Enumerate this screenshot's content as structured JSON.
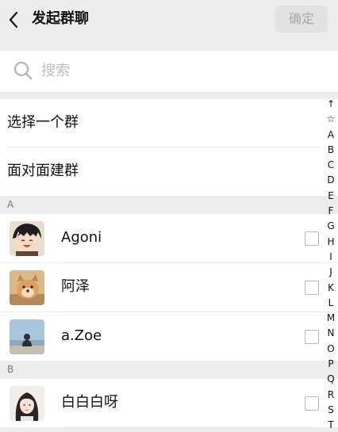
{
  "header": {
    "title": "发起群聊",
    "confirm_label": "确定"
  },
  "search": {
    "placeholder": "搜索"
  },
  "actions": [
    {
      "label": "选择一个群"
    },
    {
      "label": "面对面建群"
    }
  ],
  "sections": [
    {
      "letter": "A",
      "contacts": [
        {
          "name": "Agoni"
        },
        {
          "name": "阿泽"
        },
        {
          "name": "a.Zoe"
        }
      ]
    },
    {
      "letter": "B",
      "contacts": [
        {
          "name": "白白白呀"
        }
      ]
    }
  ],
  "index_letters": [
    "↑",
    "☆",
    "A",
    "B",
    "C",
    "D",
    "E",
    "F",
    "G",
    "H",
    "I",
    "J",
    "K",
    "L",
    "M",
    "N",
    "O",
    "P",
    "Q",
    "R",
    "S",
    "T"
  ]
}
